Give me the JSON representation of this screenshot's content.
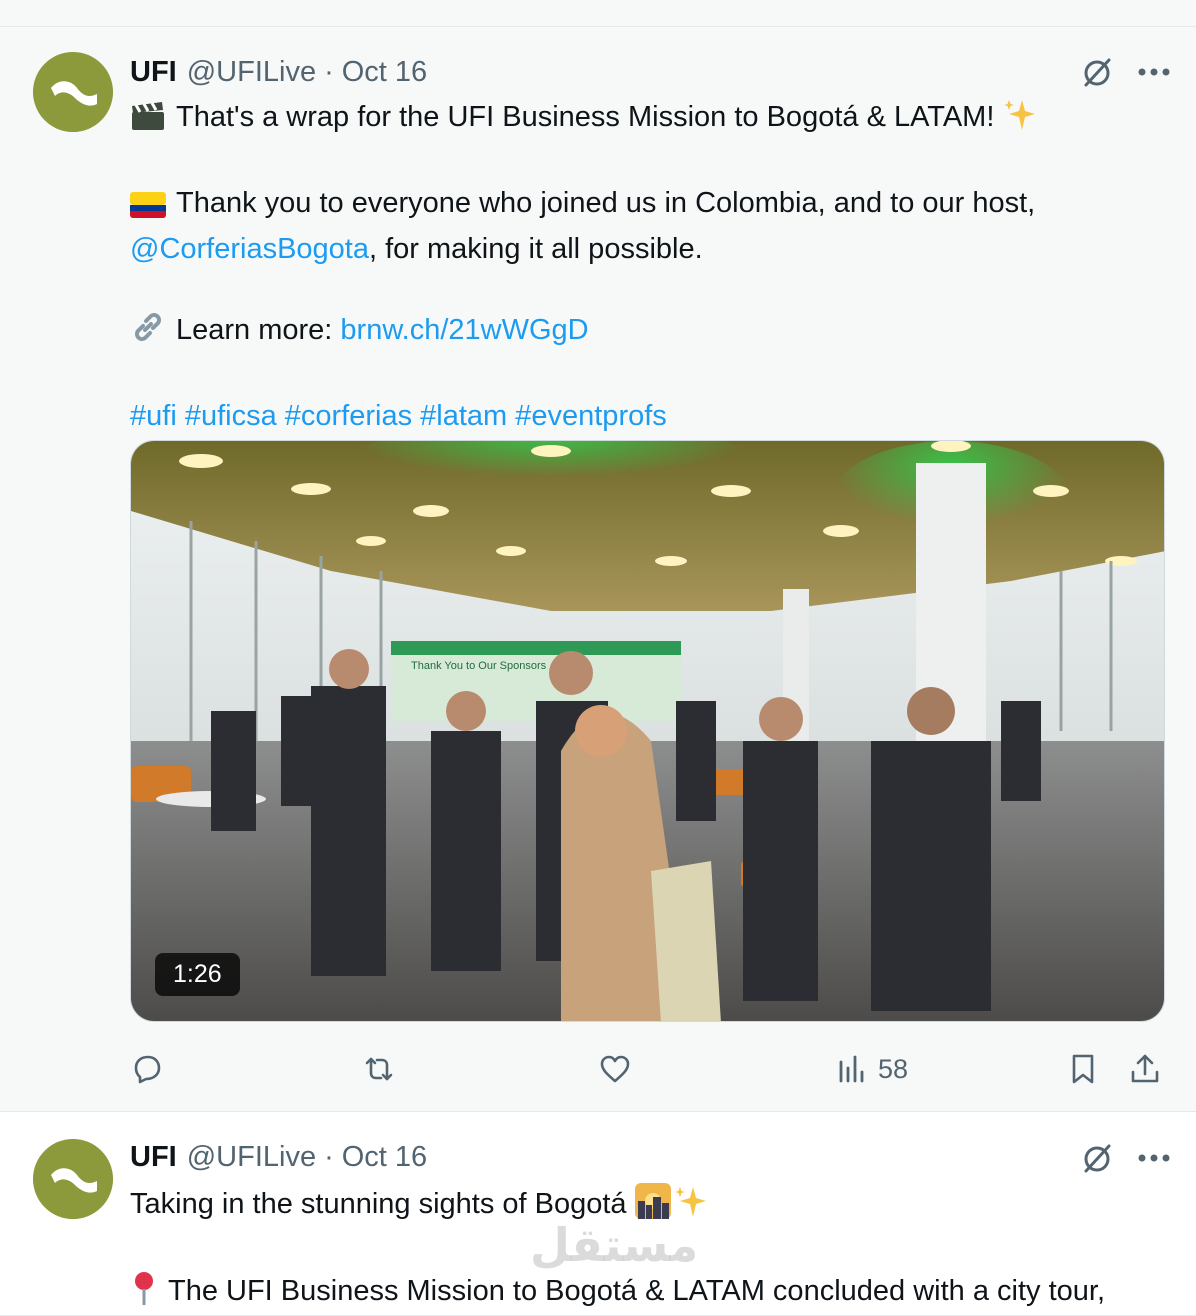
{
  "tweets": [
    {
      "author": {
        "name": "UFI",
        "handle": "@UFILive",
        "date": "Oct 16"
      },
      "text": {
        "line1": "That's a wrap for the UFI Business Mission to Bogotá & LATAM!",
        "line2a": "Thank you to everyone who joined us in Colombia, and to our host,",
        "mention": "@CorferiasBogota",
        "line2b": ", for making it all possible.",
        "learn_more_label": "Learn more:",
        "learn_more_link": "brnw.ch/21wWGgD",
        "hashtags": "#ufi #uficsa #corferias #latam #eventprofs"
      },
      "emojis": {
        "clapper": "clapper-board",
        "sparkles": "sparkles",
        "flag": "flag-colombia",
        "link": "link"
      },
      "media": {
        "type": "video",
        "duration": "1:26",
        "banner_text": "Thank You to Our Sponsors"
      },
      "stats": {
        "views": "58"
      }
    },
    {
      "author": {
        "name": "UFI",
        "handle": "@UFILive",
        "date": "Oct 16"
      },
      "text": {
        "line1": "Taking in the stunning sights of Bogotá",
        "line2": "The UFI Business Mission to Bogotá & LATAM concluded with a city tour,"
      },
      "emojis": {
        "city": "city-sunrise",
        "sparkles": "sparkles",
        "pin": "round-pushpin"
      },
      "watermark": "مستقل"
    }
  ],
  "colors": {
    "link": "#1d9bf0",
    "avatar": "#8c9a3c",
    "muted": "#536471"
  }
}
